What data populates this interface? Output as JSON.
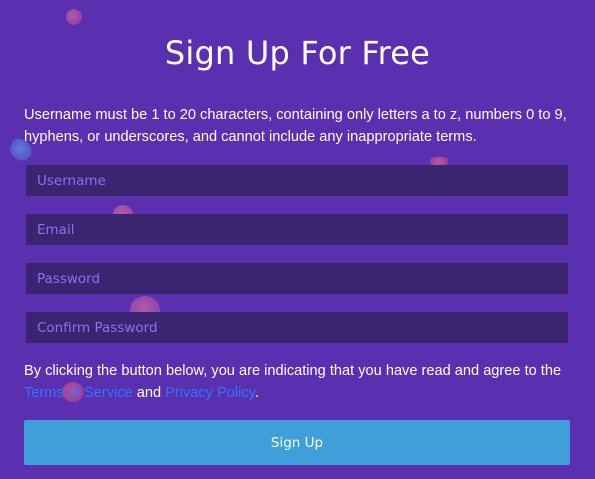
{
  "page": {
    "title": "Sign Up For Free",
    "notice": "Username must be 1 to 20 characters, containing only letters a to z, numbers 0 to 9, hyphens, or underscores, and cannot include any inappropriate terms."
  },
  "form": {
    "username": {
      "placeholder": "Username",
      "value": ""
    },
    "email": {
      "placeholder": "Email",
      "value": ""
    },
    "password": {
      "placeholder": "Password",
      "value": ""
    },
    "confirm_password": {
      "placeholder": "Confirm Password",
      "value": ""
    }
  },
  "agreement": {
    "prefix": "By clicking the button below, you are indicating that you have read and agree to the ",
    "terms_link": "Terms of Service",
    "middle": " and ",
    "privacy_link": "Privacy Policy",
    "suffix": "."
  },
  "actions": {
    "signup_label": "Sign Up"
  },
  "colors": {
    "background": "#5a2fb0",
    "field_bg": "#3a2570",
    "placeholder": "#8f6ff2",
    "link": "#2f74ff",
    "button": "#3f9fd9"
  }
}
